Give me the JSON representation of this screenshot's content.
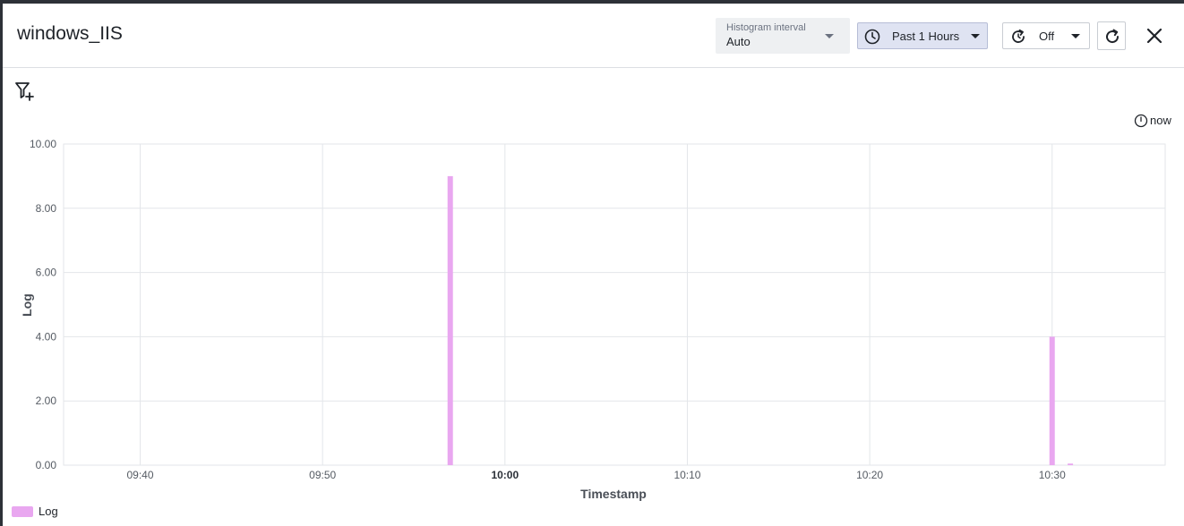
{
  "header": {
    "title": "windows_IIS",
    "histogram_label": "Histogram interval",
    "histogram_value": "Auto",
    "time_range": "Past 1 Hours",
    "auto_refresh": "Off"
  },
  "now_label": "now",
  "legend": {
    "label": "Log"
  },
  "colors": {
    "bar": "#e9a7f0",
    "accent_btn": "#dfe3f2"
  },
  "icons": [
    "clock-icon",
    "refresh-cycle-icon",
    "reload-icon",
    "close-icon",
    "filter-add-icon",
    "now-clock-icon"
  ],
  "chart_data": {
    "type": "bar",
    "xlabel": "Timestamp",
    "ylabel": "Log",
    "ylim": [
      0,
      10
    ],
    "y_ticks": [
      "0.00",
      "2.00",
      "4.00",
      "6.00",
      "8.00",
      "10.00"
    ],
    "x_ticks": [
      "09:40",
      "09:50",
      "10:00",
      "10:10",
      "10:20",
      "10:30"
    ],
    "x_range_minutes": [
      575.8,
      636.2
    ],
    "grid": true,
    "legend_position": "bottom-left",
    "series": [
      {
        "name": "Log",
        "points": [
          {
            "x": "09:57",
            "y": 9
          },
          {
            "x": "10:30",
            "y": 4
          },
          {
            "x": "10:31",
            "y": 0.05
          }
        ]
      }
    ]
  }
}
